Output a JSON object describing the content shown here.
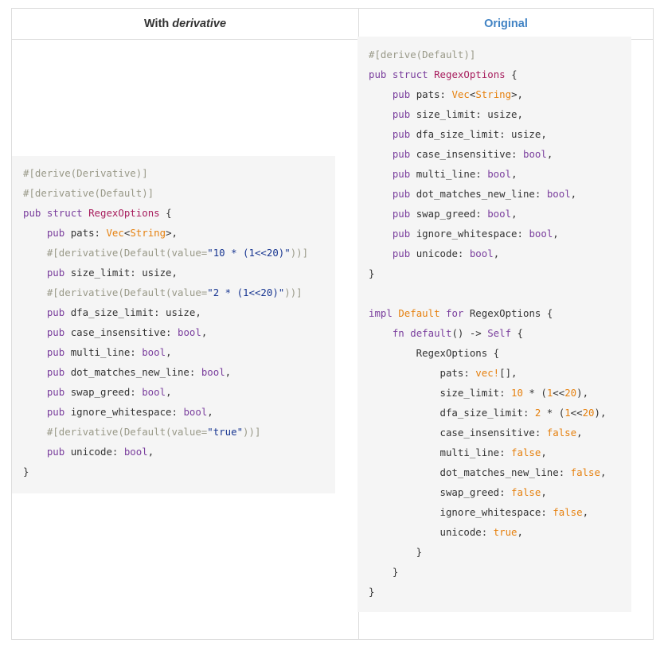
{
  "headers": {
    "left_prefix": "With ",
    "left_emphasis": "derivative",
    "right": "Original"
  },
  "left_code": [
    "#[derive(Derivative)]",
    "#[derivative(Default)]",
    "pub struct RegexOptions {",
    "    pub pats: Vec<String>,",
    "    #[derivative(Default(value=\"10 * (1<<20)\"))]",
    "    pub size_limit: usize,",
    "    #[derivative(Default(value=\"2 * (1<<20)\"))]",
    "    pub dfa_size_limit: usize,",
    "    pub case_insensitive: bool,",
    "    pub multi_line: bool,",
    "    pub dot_matches_new_line: bool,",
    "    pub swap_greed: bool,",
    "    pub ignore_whitespace: bool,",
    "    #[derivative(Default(value=\"true\"))]",
    "    pub unicode: bool,",
    "}"
  ],
  "right_code": [
    "#[derive(Default)]",
    "pub struct RegexOptions {",
    "    pub pats: Vec<String>,",
    "    pub size_limit: usize,",
    "    pub dfa_size_limit: usize,",
    "    pub case_insensitive: bool,",
    "    pub multi_line: bool,",
    "    pub dot_matches_new_line: bool,",
    "    pub swap_greed: bool,",
    "    pub ignore_whitespace: bool,",
    "    pub unicode: bool,",
    "}",
    "",
    "impl Default for RegexOptions {",
    "    fn default() -> Self {",
    "        RegexOptions {",
    "            pats: vec![],",
    "            size_limit: 10 * (1<<20),",
    "            dfa_size_limit: 2 * (1<<20),",
    "            case_insensitive: false,",
    "            multi_line: false,",
    "            dot_matches_new_line: false,",
    "            swap_greed: false,",
    "            ignore_whitespace: false,",
    "            unicode: true,",
    "        }",
    "    }",
    "}"
  ]
}
